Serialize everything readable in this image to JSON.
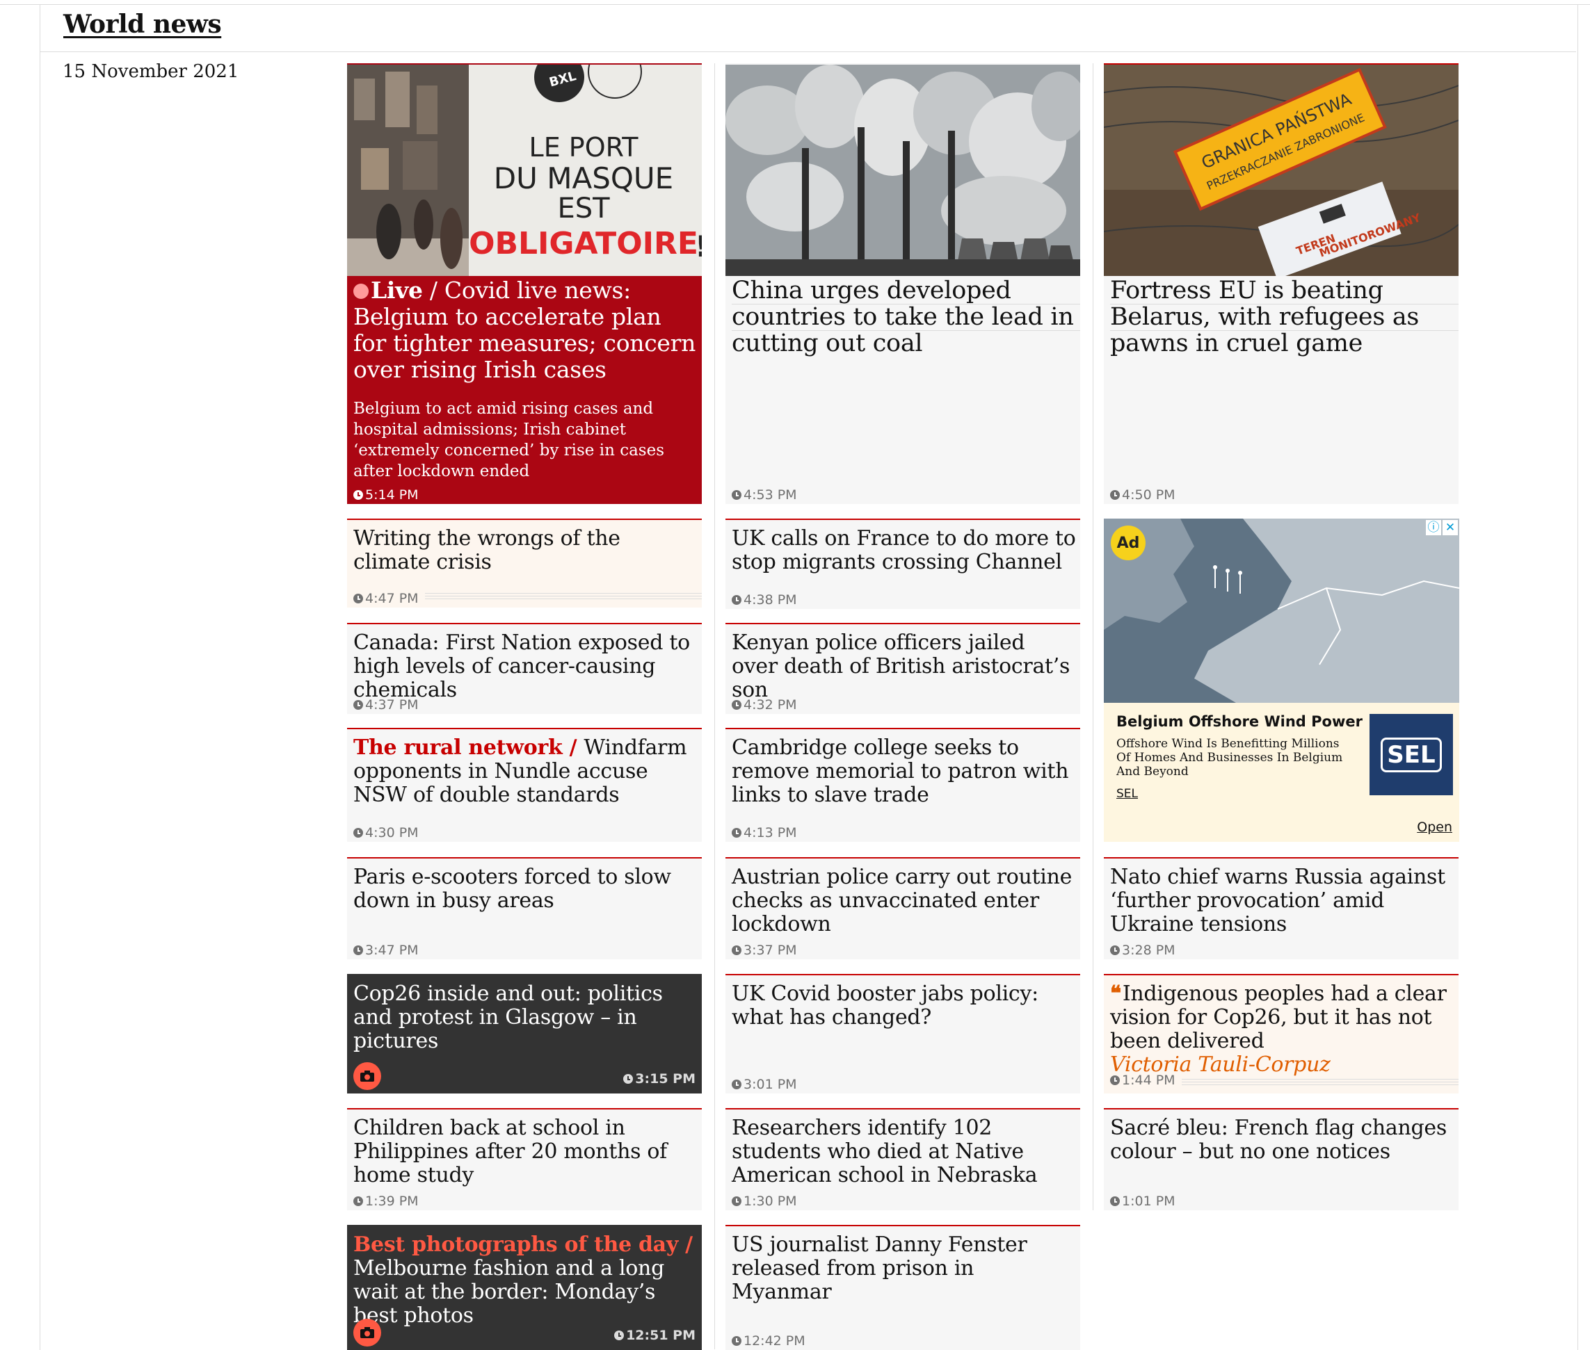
{
  "section": {
    "title": "World news",
    "date": "15 November 2021"
  },
  "cards": {
    "live": {
      "kicker": "Live",
      "sep": " / ",
      "headline": "Covid live news: Belgium to accelerate plan for tighter measures; concern over rising Irish cases",
      "standfirst": "Belgium to act amid rising cases and hospital admissions; Irish cabinet ‘extremely concerned’ by rise in cases after lockdown ended",
      "time": "5:14 PM",
      "image_text": {
        "badge": "BXL",
        "l1": "LE PORT",
        "l2": "DU MASQUE",
        "l3": "EST",
        "l4": "OBLIGATOIRE",
        "ex": "!"
      }
    },
    "china": {
      "headline": "China urges developed countries to take the lead in cutting out coal",
      "time": "4:53 PM"
    },
    "fortress": {
      "headline": "Fortress EU is beating Belarus, with refugees as pawns in cruel game",
      "time": "4:50 PM",
      "image_text": {
        "sign1": "GRANICA PAŃSTWA",
        "sign2": "PRZEKRACZANIE ZABRONIONE",
        "sign3": "TEREN",
        "sign4": "MONITOROWANY"
      }
    },
    "climate": {
      "headline": "Writing the wrongs of the climate crisis",
      "time": "4:47 PM"
    },
    "ukcalls": {
      "headline": "UK calls on France to do more to stop migrants crossing Channel",
      "time": "4:38 PM"
    },
    "canada": {
      "headline": "Canada: First Nation exposed to high levels of cancer-causing chemicals",
      "time": "4:37 PM"
    },
    "kenyan": {
      "headline": "Kenyan police officers jailed over death of British aristocrat’s son",
      "time": "4:32 PM"
    },
    "rural": {
      "kicker": "The rural network",
      "sep": " / ",
      "headline": "Windfarm opponents in Nundle accuse NSW of double standards",
      "time": "4:30 PM"
    },
    "cambridge": {
      "headline": "Cambridge college seeks to remove memorial to patron with links to slave trade",
      "time": "4:13 PM"
    },
    "paris": {
      "headline": "Paris e-scooters forced to slow down in busy areas",
      "time": "3:47 PM"
    },
    "austrian": {
      "headline": "Austrian police carry out routine checks as unvaccinated enter lockdown",
      "time": "3:37 PM"
    },
    "nato": {
      "headline": "Nato chief warns Russia against ‘further provocation’ amid Ukraine tensions",
      "time": "3:28 PM"
    },
    "cop26": {
      "headline": "Cop26 inside and out: politics and protest in Glasgow – in pictures",
      "time": "3:15 PM"
    },
    "booster": {
      "headline": "UK Covid booster jabs policy: what has changed?",
      "time": "3:01 PM"
    },
    "indigenous": {
      "headline": "Indigenous peoples had a clear vision for Cop26, but it has not been delivered",
      "byline": "Victoria Tauli-Corpuz",
      "time": "1:44 PM"
    },
    "philippines": {
      "headline": "Children back at school in Philippines after 20 months of home study",
      "time": "1:39 PM"
    },
    "researchers": {
      "headline": "Researchers identify 102 students who died at Native American school in Nebraska",
      "time": "1:30 PM"
    },
    "sacre": {
      "headline": "Sacré bleu: French flag changes colour – but no one notices",
      "time": "1:01 PM"
    },
    "bestphotos": {
      "kicker": "Best photographs of the day",
      "sep": " /",
      "headline": "Melbourne fashion and a long wait at the border: Monday’s best photos",
      "time": "12:51 PM"
    },
    "fenster": {
      "headline": "US journalist Danny Fenster released from prison in Myanmar",
      "time": "12:42 PM"
    }
  },
  "ad": {
    "badge": "Ad",
    "info_icon": "ⓘ",
    "close_icon": "✕",
    "title": "Belgium Offshore Wind Power",
    "description": "Offshore Wind Is Benefitting Millions Of Homes And Businesses In Belgium And Beyond",
    "brand": "SEL",
    "logo_text": "SEL",
    "cta": "Open"
  },
  "colors": {
    "live": "#ab0613",
    "accent": "#c70000",
    "gallery": "#333333",
    "opinion": "#e05e00",
    "photo_kicker": "#ff5943",
    "card_bg": "#f6f6f6",
    "ad_bg": "#fef6e0"
  }
}
